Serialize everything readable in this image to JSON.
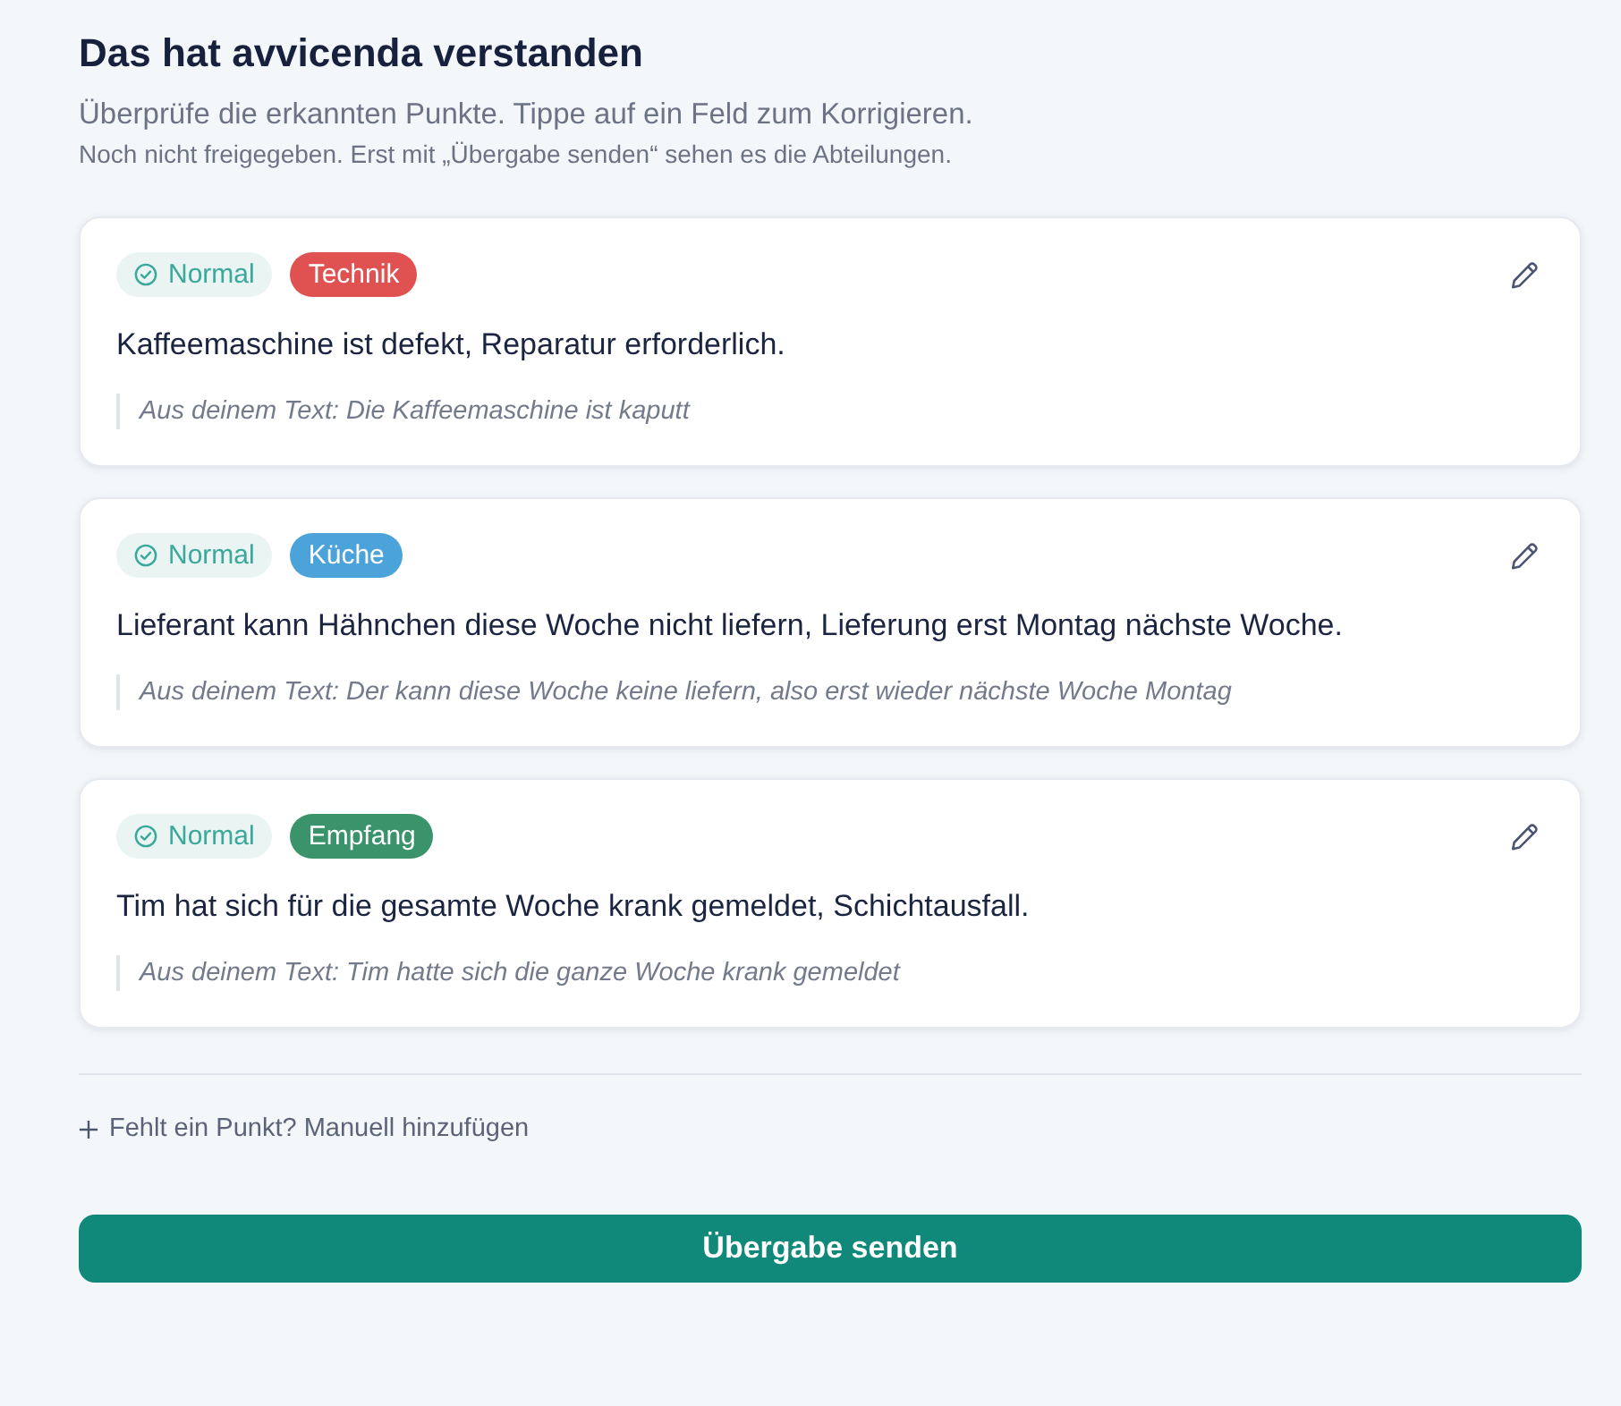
{
  "header": {
    "title": "Das hat avvicenda verstanden",
    "subtitle": "Überprüfe die erkannten Punkte. Tippe auf ein Feld zum Korrigieren.",
    "note": "Noch nicht freigegeben. Erst mit „Übergabe senden“ sehen es die Abteilungen."
  },
  "items": [
    {
      "priority": "Normal",
      "department": {
        "label": "Technik",
        "color": "#e05252"
      },
      "summary": "Kaffeemaschine ist defekt, Reparatur erforderlich.",
      "source": "Aus deinem Text: Die Kaffeemaschine ist kaputt"
    },
    {
      "priority": "Normal",
      "department": {
        "label": "Küche",
        "color": "#4ca3d9"
      },
      "summary": "Lieferant kann Hähnchen diese Woche nicht liefern, Lieferung erst Montag nächste Woche.",
      "source": "Aus deinem Text: Der kann diese Woche keine liefern, also erst wieder nächste Woche Montag"
    },
    {
      "priority": "Normal",
      "department": {
        "label": "Empfang",
        "color": "#3a936a"
      },
      "summary": "Tim hat sich für die gesamte Woche krank gemeldet, Schichtausfall.",
      "source": "Aus deinem Text: Tim hatte sich die ganze Woche krank gemeldet"
    }
  ],
  "add_link": {
    "label": "Fehlt ein Punkt? Manuell hinzufügen"
  },
  "submit_button": {
    "label": "Übergabe senden"
  }
}
